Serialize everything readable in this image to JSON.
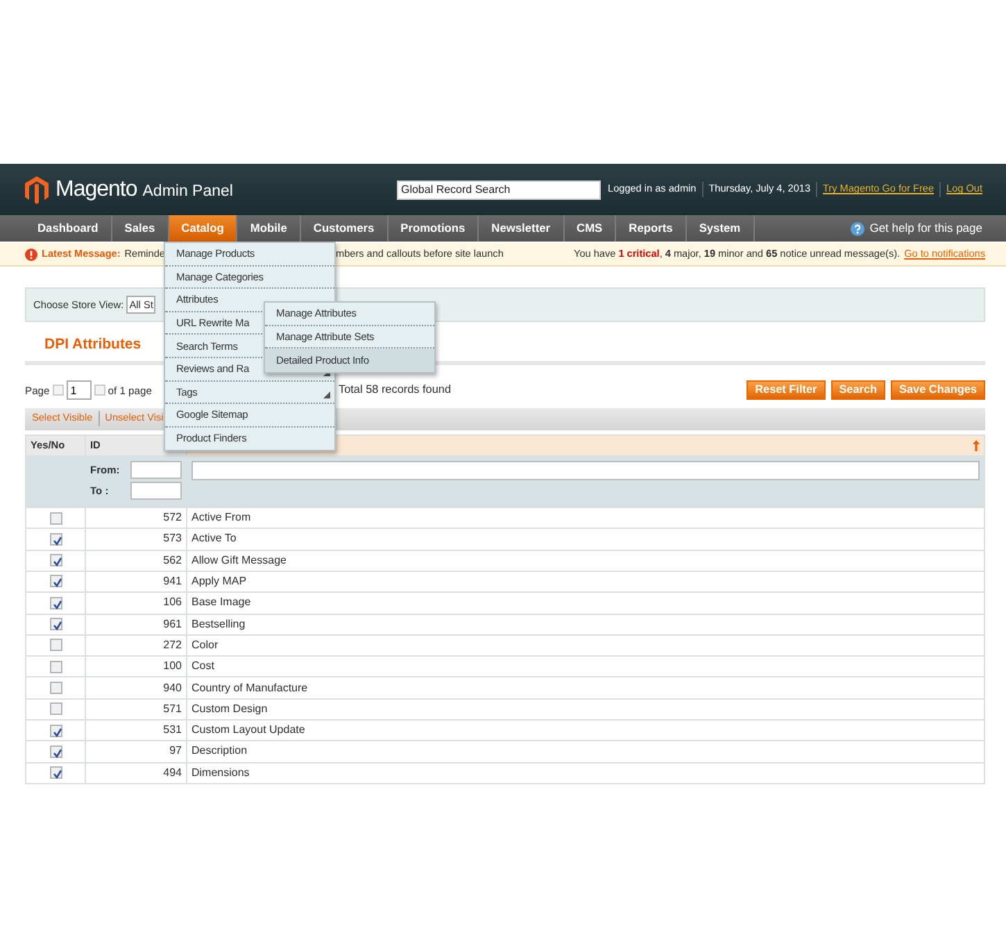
{
  "header": {
    "logo_word": "Magento",
    "logo_suffix": "Admin Panel",
    "search": {
      "placeholder": "Global Record Search"
    },
    "user_links": [
      {
        "text": "Logged in as admin",
        "kind": "info"
      },
      {
        "text": "Thursday, July 4, 2013",
        "kind": "info"
      },
      {
        "text": "Try Magento Go for Free",
        "kind": "link"
      },
      {
        "text": "Log Out",
        "kind": "link"
      }
    ]
  },
  "nav": {
    "items": [
      {
        "label": "Dashboard",
        "selected": false
      },
      {
        "label": "Sales",
        "selected": false
      },
      {
        "label": "Catalog",
        "selected": true
      },
      {
        "label": "Mobile",
        "selected": false
      },
      {
        "label": "Customers",
        "selected": false
      },
      {
        "label": "Promotions",
        "selected": false
      },
      {
        "label": "Newsletter",
        "selected": false
      },
      {
        "label": "CMS",
        "selected": false
      },
      {
        "label": "Reports",
        "selected": false
      },
      {
        "label": "System",
        "selected": false
      }
    ],
    "help": "Get help for this page"
  },
  "message_bar": {
    "label": "Latest Message:",
    "text_start": "Reminde",
    "text_end": "mbers and callouts before site launch",
    "notice": [
      {
        "text": "You have ",
        "kind": "plain"
      },
      {
        "text": "1 critical",
        "kind": "critical"
      },
      {
        "text": ", ",
        "kind": "plain"
      },
      {
        "text": "4",
        "kind": "bold"
      },
      {
        "text": " major, ",
        "kind": "plain"
      },
      {
        "text": "19",
        "kind": "bold"
      },
      {
        "text": " minor and ",
        "kind": "plain"
      },
      {
        "text": "65",
        "kind": "bold"
      },
      {
        "text": " notice unread message(s).",
        "kind": "plain"
      }
    ],
    "link": "Go to notifications"
  },
  "store_view": {
    "label": "Choose Store View:",
    "value": "All St"
  },
  "title": "DPI Attributes",
  "pager": {
    "label": "Page",
    "page": "1",
    "of_pages": "of 1 page",
    "total": "Total 58 records found"
  },
  "buttons": [
    "Reset Filter",
    "Search",
    "Save Changes"
  ],
  "mass_actions": [
    "Select Visible",
    "Unselect Visi"
  ],
  "table": {
    "columns": [
      "Yes/No",
      "ID"
    ],
    "filter": {
      "from_label": "From:",
      "to_label": "To :"
    },
    "rows": [
      {
        "checked": false,
        "id": "572",
        "name": "Active From"
      },
      {
        "checked": true,
        "id": "573",
        "name": "Active To"
      },
      {
        "checked": true,
        "id": "562",
        "name": "Allow Gift Message"
      },
      {
        "checked": true,
        "id": "941",
        "name": "Apply MAP"
      },
      {
        "checked": true,
        "id": "106",
        "name": "Base Image"
      },
      {
        "checked": true,
        "id": "961",
        "name": "Bestselling"
      },
      {
        "checked": false,
        "id": "272",
        "name": "Color"
      },
      {
        "checked": false,
        "id": "100",
        "name": "Cost"
      },
      {
        "checked": false,
        "id": "940",
        "name": "Country of Manufacture"
      },
      {
        "checked": false,
        "id": "571",
        "name": "Custom Design"
      },
      {
        "checked": true,
        "id": "531",
        "name": "Custom Layout Update"
      },
      {
        "checked": true,
        "id": "97",
        "name": "Description"
      },
      {
        "checked": true,
        "id": "494",
        "name": "Dimensions"
      }
    ]
  },
  "catalog_menu": {
    "items": [
      {
        "label": "Manage Products",
        "has_children": false
      },
      {
        "label": "Manage Categories",
        "has_children": false
      },
      {
        "label": "Attributes"
      },
      {
        "label": "URL Rewrite Ma"
      },
      {
        "label": "Search Terms"
      },
      {
        "label": "Reviews and Ra",
        "has_children": true
      },
      {
        "label": "Tags",
        "has_children": true
      },
      {
        "label": "Google Sitemap",
        "has_children": false
      },
      {
        "label": "Product Finders",
        "has_children": false
      }
    ],
    "submenu": [
      {
        "label": "Manage Attributes",
        "selected": false
      },
      {
        "label": "Manage Attribute Sets",
        "selected": false
      },
      {
        "label": "Detailed Product Info",
        "selected": true
      }
    ]
  }
}
